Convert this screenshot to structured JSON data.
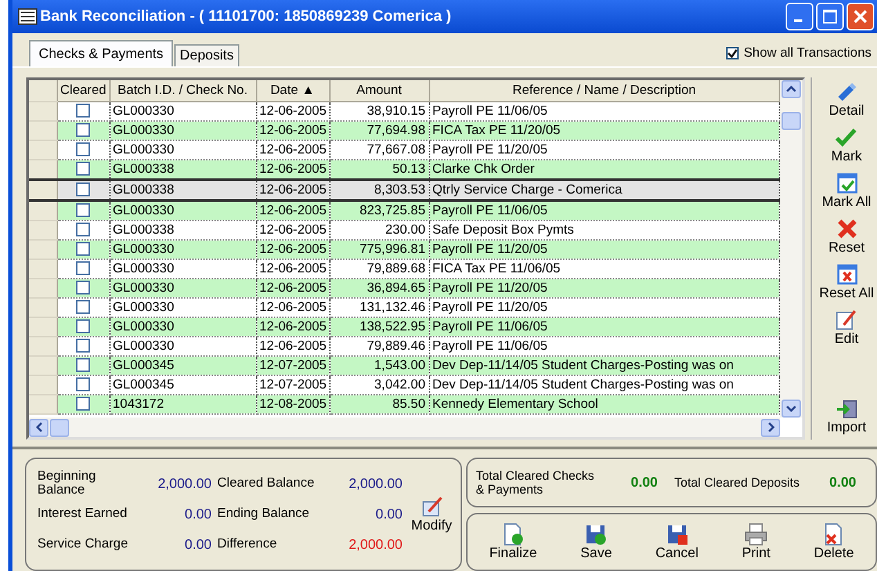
{
  "window": {
    "title": "Bank Reconciliation - ( 11101700: 1850869239 Comerica )"
  },
  "tabs": [
    {
      "label": "Checks & Payments",
      "selected": true
    },
    {
      "label": "Deposits",
      "selected": false
    }
  ],
  "show_all": {
    "label": "Show all Transactions",
    "checked": true
  },
  "table": {
    "columns": [
      "Cleared",
      "Batch I.D. / Check No.",
      "Date ▲",
      "Amount",
      "Reference / Name / Description"
    ],
    "rows": [
      {
        "cleared": false,
        "selected": false,
        "batch": "GL000330",
        "date": "12-06-2005",
        "amount": "38,910.15",
        "reference": "Payroll PE 11/06/05"
      },
      {
        "cleared": false,
        "selected": false,
        "batch": "GL000330",
        "date": "12-06-2005",
        "amount": "77,694.98",
        "reference": "FICA Tax PE 11/20/05"
      },
      {
        "cleared": false,
        "selected": false,
        "batch": "GL000330",
        "date": "12-06-2005",
        "amount": "77,667.08",
        "reference": "Payroll PE 11/20/05"
      },
      {
        "cleared": false,
        "selected": false,
        "batch": "GL000338",
        "date": "12-06-2005",
        "amount": "50.13",
        "reference": "Clarke Chk Order"
      },
      {
        "cleared": false,
        "selected": true,
        "batch": "GL000338",
        "date": "12-06-2005",
        "amount": "8,303.53",
        "reference": "Qtrly Service Charge - Comerica"
      },
      {
        "cleared": false,
        "selected": false,
        "batch": "GL000330",
        "date": "12-06-2005",
        "amount": "823,725.85",
        "reference": "Payroll PE 11/06/05"
      },
      {
        "cleared": false,
        "selected": false,
        "batch": "GL000338",
        "date": "12-06-2005",
        "amount": "230.00",
        "reference": "Safe Deposit Box Pymts"
      },
      {
        "cleared": false,
        "selected": false,
        "batch": "GL000330",
        "date": "12-06-2005",
        "amount": "775,996.81",
        "reference": "Payroll PE 11/20/05"
      },
      {
        "cleared": false,
        "selected": false,
        "batch": "GL000330",
        "date": "12-06-2005",
        "amount": "79,889.68",
        "reference": "FICA Tax PE 11/06/05"
      },
      {
        "cleared": false,
        "selected": false,
        "batch": "GL000330",
        "date": "12-06-2005",
        "amount": "36,894.65",
        "reference": "Payroll PE 11/20/05"
      },
      {
        "cleared": false,
        "selected": false,
        "batch": "GL000330",
        "date": "12-06-2005",
        "amount": "131,132.46",
        "reference": "Payroll PE 11/20/05"
      },
      {
        "cleared": false,
        "selected": false,
        "batch": "GL000330",
        "date": "12-06-2005",
        "amount": "138,522.95",
        "reference": "Payroll PE 11/06/05"
      },
      {
        "cleared": false,
        "selected": false,
        "batch": "GL000330",
        "date": "12-06-2005",
        "amount": "79,889.46",
        "reference": "Payroll PE 11/06/05"
      },
      {
        "cleared": false,
        "selected": false,
        "batch": "GL000345",
        "date": "12-07-2005",
        "amount": "1,543.00",
        "reference": "Dev Dep-11/14/05 Student Charges-Posting was on"
      },
      {
        "cleared": false,
        "selected": false,
        "batch": "GL000345",
        "date": "12-07-2005",
        "amount": "3,042.00",
        "reference": "Dev Dep-11/14/05 Student Charges-Posting was on"
      },
      {
        "cleared": false,
        "selected": false,
        "batch": "1043172",
        "date": "12-08-2005",
        "amount": "85.50",
        "reference": "Kennedy Elementary School"
      }
    ]
  },
  "side_buttons": [
    {
      "label": "Detail",
      "kind": "detail"
    },
    {
      "label": "Mark",
      "kind": "mark"
    },
    {
      "label": "Mark All",
      "kind": "markall"
    },
    {
      "label": "Reset",
      "kind": "reset"
    },
    {
      "label": "Reset All",
      "kind": "resetall"
    },
    {
      "label": "Edit",
      "kind": "edit"
    }
  ],
  "import_button": {
    "label": "Import"
  },
  "balances": [
    {
      "label": "Beginning Balance",
      "value": "2,000.00",
      "alert": false
    },
    {
      "label": "Cleared Balance",
      "value": "2,000.00",
      "alert": false
    },
    {
      "label": "Interest Earned",
      "value": "0.00",
      "alert": false
    },
    {
      "label": "Ending Balance",
      "value": "0.00",
      "alert": false
    },
    {
      "label": "Service Charge",
      "value": "0.00",
      "alert": false
    },
    {
      "label": "Difference",
      "value": "2,000.00",
      "alert": true
    }
  ],
  "modify_button": {
    "label": "Modify"
  },
  "totals": [
    {
      "label": "Total Cleared Checks & Payments",
      "value": "0.00"
    },
    {
      "label": "Total Cleared Deposits",
      "value": "0.00"
    }
  ],
  "actions": [
    {
      "label": "Finalize",
      "kind": "finalize"
    },
    {
      "label": "Save",
      "kind": "save"
    },
    {
      "label": "Cancel",
      "kind": "cancel"
    },
    {
      "label": "Print",
      "kind": "print"
    },
    {
      "label": "Delete",
      "kind": "delete"
    }
  ]
}
